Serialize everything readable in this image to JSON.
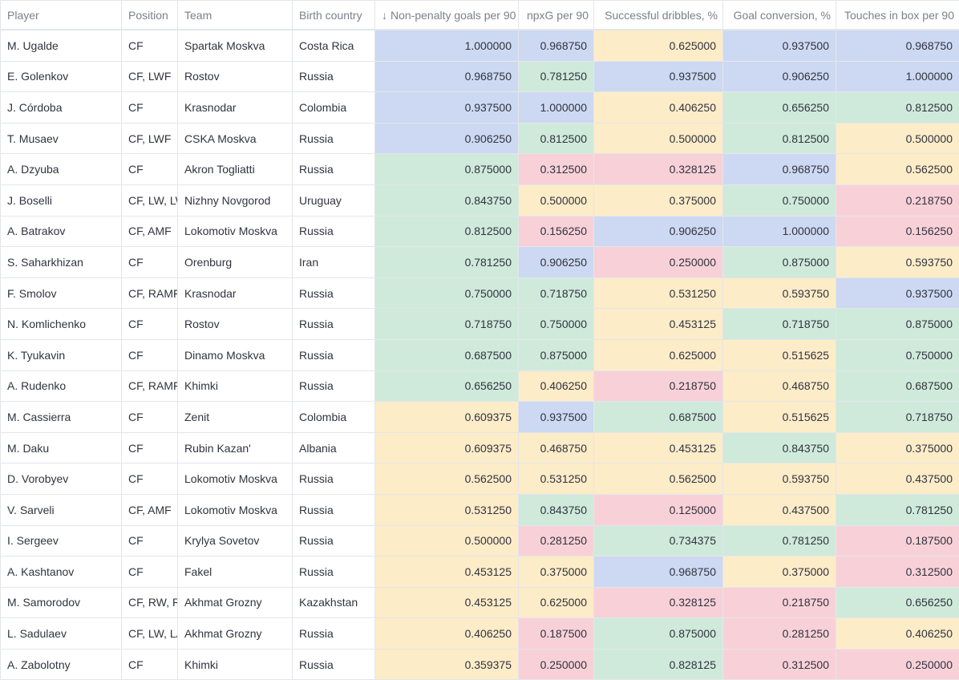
{
  "table": {
    "columns": [
      {
        "label": "Player",
        "sort": ""
      },
      {
        "label": "Position",
        "sort": ""
      },
      {
        "label": "Team",
        "sort": ""
      },
      {
        "label": "Birth country",
        "sort": ""
      },
      {
        "label": "Non-penalty goals per 90",
        "sort": "↓"
      },
      {
        "label": "npxG per 90",
        "sort": ""
      },
      {
        "label": "Successful dribbles, %",
        "sort": ""
      },
      {
        "label": "Goal conversion, %",
        "sort": ""
      },
      {
        "label": "Touches in box per 90",
        "sort": ""
      }
    ],
    "colors": {
      "blue": "#cdd9f2",
      "green": "#cfeadb",
      "yellow": "#fdecc8",
      "red": "#f8d1d8"
    },
    "rows": [
      {
        "player": "M. Ugalde",
        "position": "CF",
        "team": "Spartak Moskva",
        "country": "Costa Rica",
        "values": [
          "1.000000",
          "0.968750",
          "0.625000",
          "0.937500",
          "0.968750"
        ],
        "colors": [
          "blue",
          "blue",
          "yellow",
          "blue",
          "blue"
        ]
      },
      {
        "player": "E. Golenkov",
        "position": "CF, LWF",
        "team": "Rostov",
        "country": "Russia",
        "values": [
          "0.968750",
          "0.781250",
          "0.937500",
          "0.906250",
          "1.000000"
        ],
        "colors": [
          "blue",
          "green",
          "blue",
          "blue",
          "blue"
        ]
      },
      {
        "player": "J. Córdoba",
        "position": "CF",
        "team": "Krasnodar",
        "country": "Colombia",
        "values": [
          "0.937500",
          "1.000000",
          "0.406250",
          "0.656250",
          "0.812500"
        ],
        "colors": [
          "blue",
          "blue",
          "yellow",
          "green",
          "green"
        ]
      },
      {
        "player": "T. Musaev",
        "position": "CF, LWF",
        "team": "CSKA Moskva",
        "country": "Russia",
        "values": [
          "0.906250",
          "0.812500",
          "0.500000",
          "0.812500",
          "0.500000"
        ],
        "colors": [
          "blue",
          "green",
          "yellow",
          "green",
          "yellow"
        ]
      },
      {
        "player": "A. Dzyuba",
        "position": "CF",
        "team": "Akron Togliatti",
        "country": "Russia",
        "values": [
          "0.875000",
          "0.312500",
          "0.328125",
          "0.968750",
          "0.562500"
        ],
        "colors": [
          "green",
          "red",
          "red",
          "blue",
          "yellow"
        ]
      },
      {
        "player": "J. Boselli",
        "position": "CF, LW, LW",
        "team": "Nizhny Novgorod",
        "country": "Uruguay",
        "values": [
          "0.843750",
          "0.500000",
          "0.375000",
          "0.750000",
          "0.218750"
        ],
        "colors": [
          "green",
          "yellow",
          "yellow",
          "green",
          "red"
        ]
      },
      {
        "player": "A. Batrakov",
        "position": "CF, AMF",
        "team": "Lokomotiv Moskva",
        "country": "Russia",
        "values": [
          "0.812500",
          "0.156250",
          "0.906250",
          "1.000000",
          "0.156250"
        ],
        "colors": [
          "green",
          "red",
          "blue",
          "blue",
          "red"
        ]
      },
      {
        "player": "S. Saharkhizan",
        "position": "CF",
        "team": "Orenburg",
        "country": "Iran",
        "values": [
          "0.781250",
          "0.906250",
          "0.250000",
          "0.875000",
          "0.593750"
        ],
        "colors": [
          "green",
          "blue",
          "red",
          "green",
          "yellow"
        ]
      },
      {
        "player": "F. Smolov",
        "position": "CF, RAMF",
        "team": "Krasnodar",
        "country": "Russia",
        "values": [
          "0.750000",
          "0.718750",
          "0.531250",
          "0.593750",
          "0.937500"
        ],
        "colors": [
          "green",
          "green",
          "yellow",
          "yellow",
          "blue"
        ]
      },
      {
        "player": "N. Komlichenko",
        "position": "CF",
        "team": "Rostov",
        "country": "Russia",
        "values": [
          "0.718750",
          "0.750000",
          "0.453125",
          "0.718750",
          "0.875000"
        ],
        "colors": [
          "green",
          "green",
          "yellow",
          "green",
          "green"
        ]
      },
      {
        "player": "K. Tyukavin",
        "position": "CF",
        "team": "Dinamo Moskva",
        "country": "Russia",
        "values": [
          "0.687500",
          "0.875000",
          "0.625000",
          "0.515625",
          "0.750000"
        ],
        "colors": [
          "green",
          "green",
          "yellow",
          "yellow",
          "green"
        ]
      },
      {
        "player": "A. Rudenko",
        "position": "CF, RAMF,",
        "team": "Khimki",
        "country": "Russia",
        "values": [
          "0.656250",
          "0.406250",
          "0.218750",
          "0.468750",
          "0.687500"
        ],
        "colors": [
          "green",
          "yellow",
          "red",
          "yellow",
          "green"
        ]
      },
      {
        "player": "M. Cassierra",
        "position": "CF",
        "team": "Zenit",
        "country": "Colombia",
        "values": [
          "0.609375",
          "0.937500",
          "0.687500",
          "0.515625",
          "0.718750"
        ],
        "colors": [
          "yellow",
          "blue",
          "green",
          "yellow",
          "green"
        ]
      },
      {
        "player": "M. Daku",
        "position": "CF",
        "team": "Rubin Kazan'",
        "country": "Albania",
        "values": [
          "0.609375",
          "0.468750",
          "0.453125",
          "0.843750",
          "0.375000"
        ],
        "colors": [
          "yellow",
          "yellow",
          "yellow",
          "green",
          "yellow"
        ]
      },
      {
        "player": "D. Vorobyev",
        "position": "CF",
        "team": "Lokomotiv Moskva",
        "country": "Russia",
        "values": [
          "0.562500",
          "0.531250",
          "0.562500",
          "0.593750",
          "0.437500"
        ],
        "colors": [
          "yellow",
          "yellow",
          "yellow",
          "yellow",
          "yellow"
        ]
      },
      {
        "player": "V. Sarveli",
        "position": "CF, AMF",
        "team": "Lokomotiv Moskva",
        "country": "Russia",
        "values": [
          "0.531250",
          "0.843750",
          "0.125000",
          "0.437500",
          "0.781250"
        ],
        "colors": [
          "yellow",
          "green",
          "red",
          "yellow",
          "green"
        ]
      },
      {
        "player": "I. Sergeev",
        "position": "CF",
        "team": "Krylya Sovetov",
        "country": "Russia",
        "values": [
          "0.500000",
          "0.281250",
          "0.734375",
          "0.781250",
          "0.187500"
        ],
        "colors": [
          "yellow",
          "red",
          "green",
          "green",
          "red"
        ]
      },
      {
        "player": "A. Kashtanov",
        "position": "CF",
        "team": "Fakel",
        "country": "Russia",
        "values": [
          "0.453125",
          "0.375000",
          "0.968750",
          "0.375000",
          "0.312500"
        ],
        "colors": [
          "yellow",
          "yellow",
          "blue",
          "yellow",
          "red"
        ]
      },
      {
        "player": "M. Samorodov",
        "position": "CF, RW, RA",
        "team": "Akhmat Grozny",
        "country": "Kazakhstan",
        "values": [
          "0.453125",
          "0.625000",
          "0.328125",
          "0.218750",
          "0.656250"
        ],
        "colors": [
          "yellow",
          "yellow",
          "red",
          "red",
          "green"
        ]
      },
      {
        "player": "L. Sadulaev",
        "position": "CF, LW, LA",
        "team": "Akhmat Grozny",
        "country": "Russia",
        "values": [
          "0.406250",
          "0.187500",
          "0.875000",
          "0.281250",
          "0.406250"
        ],
        "colors": [
          "yellow",
          "red",
          "green",
          "red",
          "yellow"
        ]
      },
      {
        "player": "A. Zabolotny",
        "position": "CF",
        "team": "Khimki",
        "country": "Russia",
        "values": [
          "0.359375",
          "0.250000",
          "0.828125",
          "0.312500",
          "0.250000"
        ],
        "colors": [
          "yellow",
          "red",
          "green",
          "red",
          "red"
        ]
      }
    ]
  }
}
